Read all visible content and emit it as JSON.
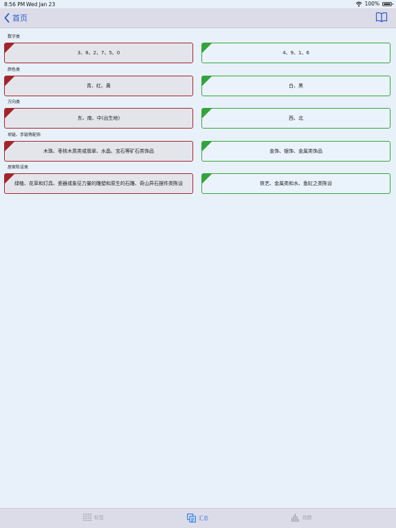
{
  "status_bar": {
    "time": "8:56 PM",
    "date": "Wed Jan 23",
    "battery": "100%",
    "icons": [
      "wifi-icon",
      "battery-icon"
    ]
  },
  "nav_bar": {
    "back_label": "首页",
    "back_icon": "chevron-left-icon",
    "right_icon": "book-icon",
    "accent": "#2b5fcf"
  },
  "sections": [
    {
      "label": "数字类",
      "bad": "3、8、2、7、5、0",
      "good": "4、9、1、6"
    },
    {
      "label": "颜色类",
      "bad": "青、红、黄",
      "good": "白、黑"
    },
    {
      "label": "方向类",
      "bad": "东、南、中(出生地)",
      "good": "西、北"
    },
    {
      "label": "项链、手链等配饰",
      "bad": "木珠、枣核木质类或翡翠、水晶、宝石等矿石类饰品",
      "good": "金饰、银饰、金属类饰品"
    },
    {
      "label": "居家陈设类",
      "bad": "绿植、花草和灯具、瓷器或象征力量的雕塑和原生的石雕、奇山异石摆件类陈设",
      "good": "铁艺、金属类和水、鱼缸之类陈设"
    }
  ],
  "colors": {
    "bad_border": "#a3252c",
    "good_border": "#34a33c",
    "background": "#e8f1fa"
  },
  "tab_bar": {
    "tags_label": "标签",
    "summary_label": "汇总",
    "index_label": "指数",
    "active": "summary"
  }
}
